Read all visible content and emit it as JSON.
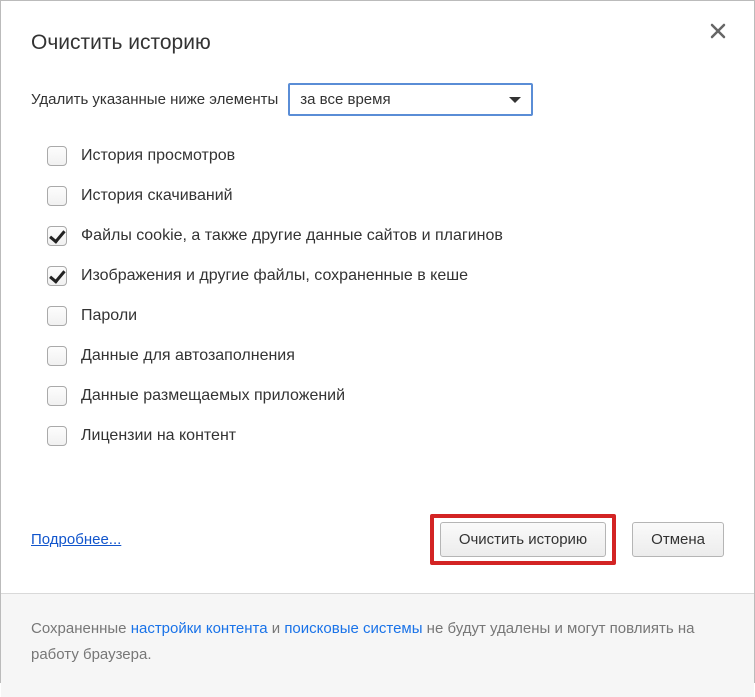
{
  "title": "Очистить историю",
  "time_row": {
    "label": "Удалить указанные ниже элементы",
    "selected": "за все время"
  },
  "options": [
    {
      "checked": false,
      "label": "История просмотров"
    },
    {
      "checked": false,
      "label": "История скачиваний"
    },
    {
      "checked": true,
      "label": "Файлы cookie, а также другие данные сайтов и плагинов"
    },
    {
      "checked": true,
      "label": "Изображения и другие файлы, сохраненные в кеше"
    },
    {
      "checked": false,
      "label": "Пароли"
    },
    {
      "checked": false,
      "label": "Данные для автозаполнения"
    },
    {
      "checked": false,
      "label": "Данные размещаемых приложений"
    },
    {
      "checked": false,
      "label": "Лицензии на контент"
    }
  ],
  "actions": {
    "learn_more": "Подробнее...",
    "clear": "Очистить историю",
    "cancel": "Отмена"
  },
  "footer": {
    "prefix": "Сохраненные ",
    "link1": "настройки контента",
    "mid": " и ",
    "link2": "поисковые системы",
    "suffix": " не будут удалены и могут повлиять на работу браузера."
  }
}
